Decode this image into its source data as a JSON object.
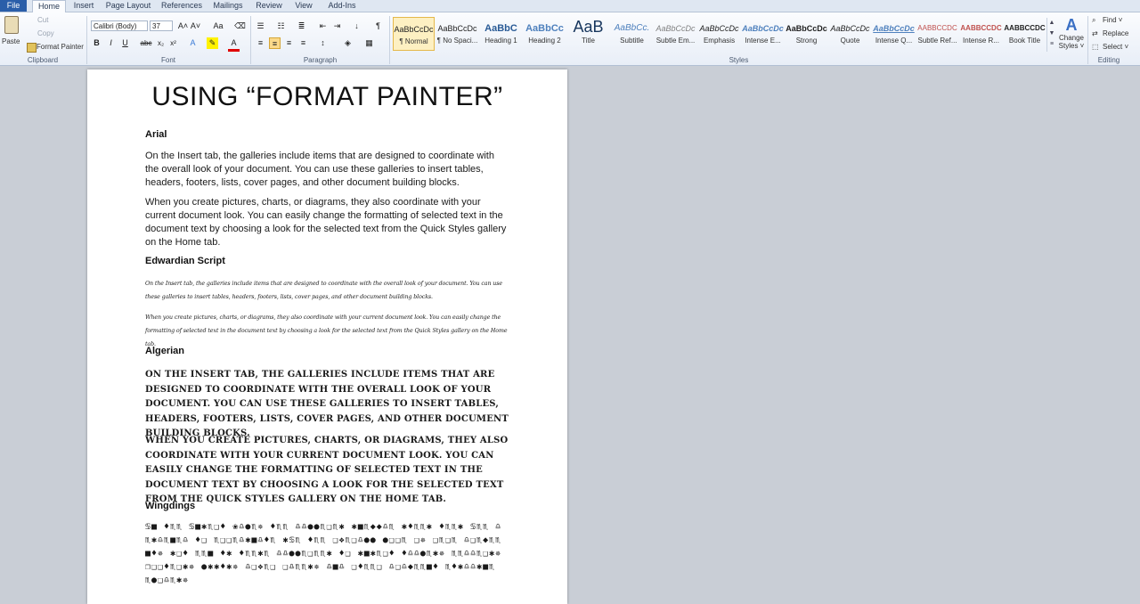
{
  "tabs": [
    "File",
    "Home",
    "Insert",
    "Page Layout",
    "References",
    "Mailings",
    "Review",
    "View",
    "Add-Ins"
  ],
  "clipboard": {
    "paste": "Paste",
    "cut": "Cut",
    "copy": "Copy",
    "format_painter": "Format Painter",
    "label": "Clipboard"
  },
  "font": {
    "name": "Calibri (Body)",
    "size": "37",
    "label": "Font",
    "grow": "A˄",
    "shrink": "A˅",
    "case": "Aa",
    "bold": "B",
    "italic": "I",
    "underline": "U",
    "strike": "abc",
    "sub": "x₂",
    "sup": "x²"
  },
  "paragraph": {
    "label": "Paragraph",
    "pilcrow": "¶"
  },
  "styles": {
    "label": "Styles",
    "items": [
      {
        "preview": "AaBbCcDc",
        "name": "¶ Normal"
      },
      {
        "preview": "AaBbCcDc",
        "name": "¶ No Spaci..."
      },
      {
        "preview": "AaBbC",
        "name": "Heading 1"
      },
      {
        "preview": "AaBbCc",
        "name": "Heading 2"
      },
      {
        "preview": "AaB",
        "name": "Title"
      },
      {
        "preview": "AaBbCc.",
        "name": "Subtitle"
      },
      {
        "preview": "AaBbCcDc",
        "name": "Subtle Em..."
      },
      {
        "preview": "AaBbCcDc",
        "name": "Emphasis"
      },
      {
        "preview": "AaBbCcDc",
        "name": "Intense E..."
      },
      {
        "preview": "AaBbCcDc",
        "name": "Strong"
      },
      {
        "preview": "AaBbCcDc",
        "name": "Quote"
      },
      {
        "preview": "AaBbCcDc",
        "name": "Intense Q..."
      },
      {
        "preview": "AABBCCDC",
        "name": "Subtle Ref..."
      },
      {
        "preview": "AABBCCDC",
        "name": "Intense R..."
      },
      {
        "preview": "AABBCCDC",
        "name": "Book Title"
      }
    ],
    "change_line1": "Change",
    "change_line2": "Styles ˅"
  },
  "editing": {
    "label": "Editing",
    "find": "Find ˅",
    "replace": "Replace",
    "select": "Select ˅"
  },
  "document": {
    "title": "USING “FORMAT PAINTER”",
    "sections": [
      {
        "heading": "Arial",
        "paragraphs": [
          "On the Insert tab, the galleries include items that are designed to coordinate with the overall look of your document. You can use these galleries to insert tables, headers, footers, lists, cover pages, and other document building blocks.",
          "When you create pictures, charts, or diagrams, they also coordinate with your current document look. You can easily change the formatting of selected text in the document text by choosing a look for the selected text from the Quick Styles gallery on the Home tab."
        ]
      },
      {
        "heading": "Edwardian Script",
        "paragraphs": [
          "On the Insert tab, the galleries include items that are designed to coordinate with the overall look of your document. You can use these galleries to insert tables, headers, footers, lists, cover pages, and other document building blocks.",
          "When you create pictures, charts, or diagrams, they also coordinate with your current document look. You can easily change the formatting of selected text in the document text by choosing a look for the selected text from the Quick Styles gallery on the Home tab."
        ]
      },
      {
        "heading": "Algerian",
        "paragraphs": [
          "On the Insert tab, the galleries include items that are designed to coordinate with the overall look of your document. You can use these galleries to insert tables, headers, footers, lists, cover pages, and other document building blocks.",
          "When you create pictures, charts, or diagrams, they also coordinate with your current document look. You can easily change the formatting of selected text in the document text by choosing a look for the selected text from the Quick Styles gallery on the Home tab."
        ]
      },
      {
        "heading": "Wingdings",
        "paragraphs": [
          "♋■ ♦♏♏ ♋■✱♏❑♦ ❀♎●♏✵ ♦♏♏ ♎♎●●♏❑♏✱ ✱■♏◆◆♎♏ ✱♦♏♏✱ ♦♏♏✱ ♋♏♏ ♎♏✱♎♏■♏♎ ♦❑ ♏❑❑♏♎✱■♎♦♏ ✱♋♏ ♦♏♏ ❑❖♏❑♎●● ●❑❑♏ ❑✵ ❑♏❑♏ ♎❑♏◆♏♏■♦✵ ✱❑♦ ♏♏■ ♦✱ ♦♏♏✱♏ ♎♎●●♏❑♏♏✱ ♦❑ ✱■✱♏❑♦ ♦♎♎●♏✱✵ ♏♏♎♎♏❑✱✵ ❐❑❑♦♏❑✱✵ ●✱✱♦✱✵ ♎❑❖♏❑ ❑♎♏♏✱✵ ♎■♎ ❑♦♏♏❑ ♎❑♎◆♏♏■♦ ♏♦✱♎♎✱■♏ ♏●❑♎♏✱✵"
        ]
      }
    ]
  }
}
